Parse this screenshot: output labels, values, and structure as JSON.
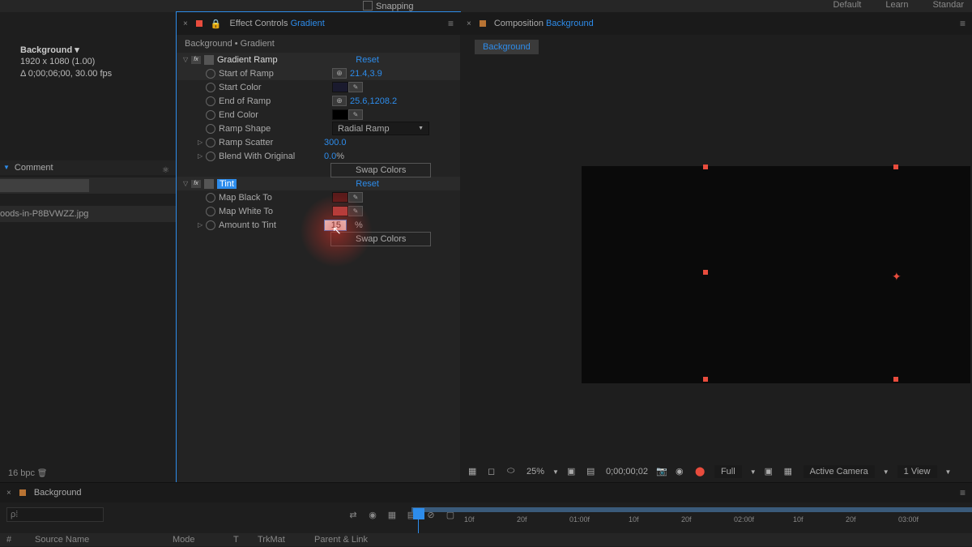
{
  "toolbar": {
    "snapping": "Snapping",
    "workspace1": "Default",
    "workspace2": "Learn",
    "workspace3": "Standar"
  },
  "project": {
    "compName": "Background ▾",
    "resolution": "1920 x 1080 (1.00)",
    "duration": "Δ 0;00;06;00, 30.00 fps",
    "commentLabel": "Comment",
    "fileRow": "oods-in-P8BVWZZ.jpg",
    "bpc": "16 bpc"
  },
  "effectsPanel": {
    "title": "Effect Controls",
    "titleLink": "Gradient",
    "breadcrumb": "Background • Gradient",
    "effects": {
      "gradientRamp": {
        "name": "Gradient Ramp",
        "reset": "Reset",
        "startOfRamp": {
          "label": "Start of Ramp",
          "value": "21.4,3.9"
        },
        "startColor": {
          "label": "Start Color"
        },
        "endOfRamp": {
          "label": "End of Ramp",
          "value": "25.6,1208.2"
        },
        "endColor": {
          "label": "End Color"
        },
        "rampShape": {
          "label": "Ramp Shape",
          "value": "Radial Ramp"
        },
        "rampScatter": {
          "label": "Ramp Scatter",
          "value": "300.0"
        },
        "blend": {
          "label": "Blend With Original",
          "value": "0.0",
          "unit": "%"
        },
        "swap": "Swap Colors"
      },
      "tint": {
        "name": "Tint",
        "reset": "Reset",
        "mapBlack": {
          "label": "Map Black To"
        },
        "mapWhite": {
          "label": "Map White To"
        },
        "amount": {
          "label": "Amount to Tint",
          "value": "15",
          "unit": "%"
        },
        "swap": "Swap Colors"
      }
    }
  },
  "compPanel": {
    "title": "Composition",
    "titleLink": "Background",
    "flowTab": "Background"
  },
  "viewer": {
    "zoom": "25%",
    "timecode": "0;00;00;02",
    "quality": "Full",
    "camera": "Active Camera",
    "views": "1 View"
  },
  "timeline": {
    "tab": "Background",
    "searchPlaceholder": "ρ⁞",
    "ticks": [
      "10f",
      "20f",
      "01:00f",
      "10f",
      "20f",
      "02:00f",
      "10f",
      "20f",
      "03:00f"
    ],
    "cols": {
      "num": "#",
      "src": "Source Name",
      "mode": "Mode",
      "t": "T",
      "trk": "TrkMat",
      "parent": "Parent & Link"
    }
  },
  "colors": {
    "startColor": "#1a1a2e",
    "endColor": "#000000",
    "tintBlack": "#5a1a1a",
    "tintWhite": "#aa4040"
  }
}
